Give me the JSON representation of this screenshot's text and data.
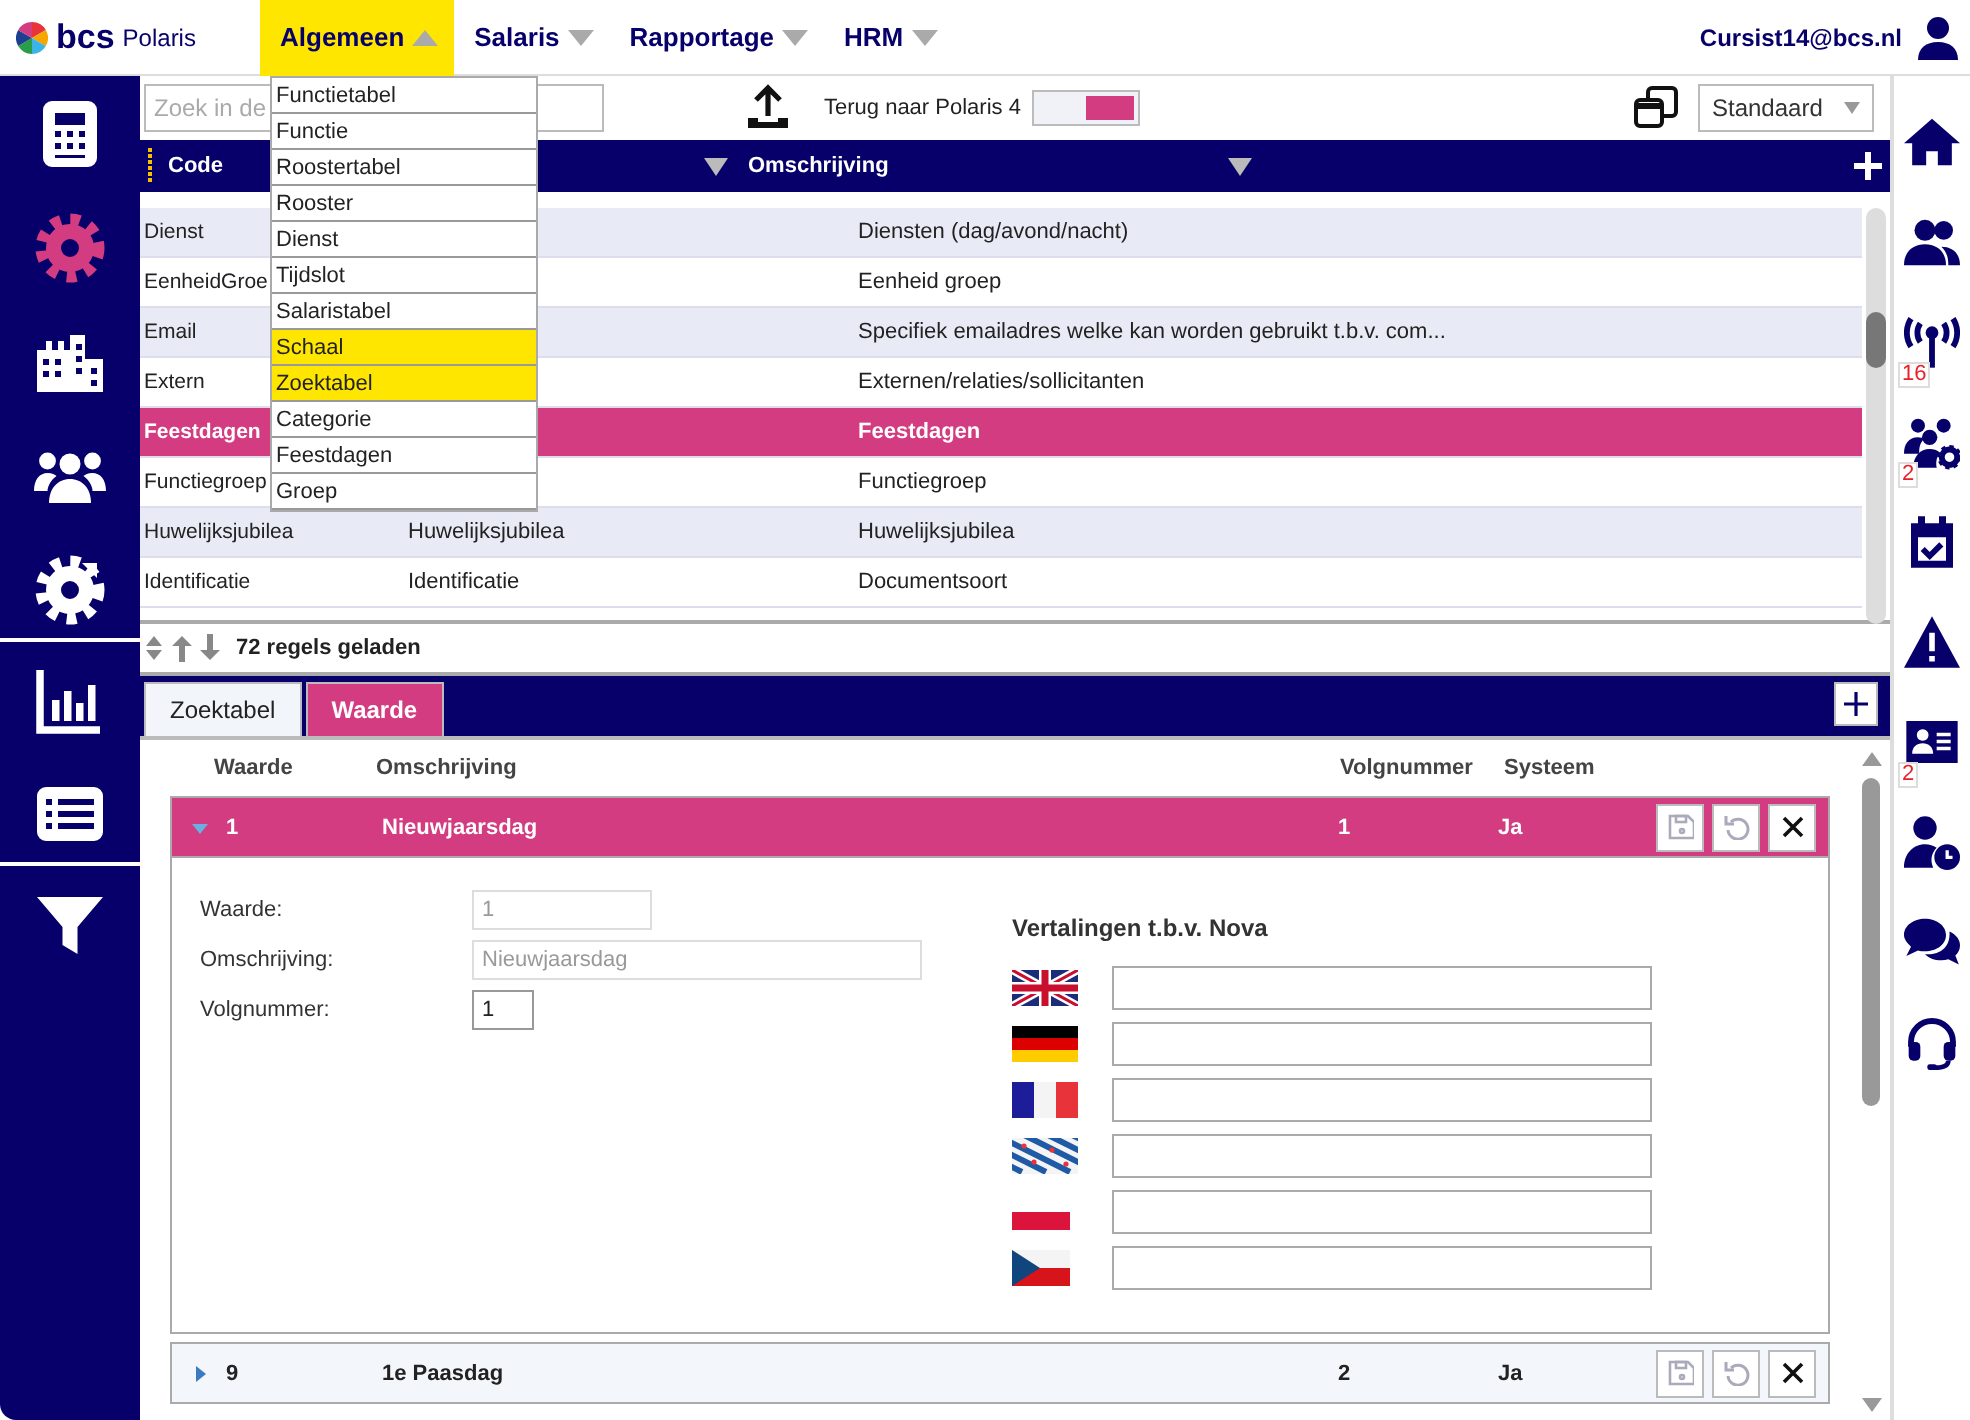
{
  "brand": {
    "name": "bcs",
    "product": "Polaris"
  },
  "menu": [
    {
      "label": "Algemeen",
      "expanded": true,
      "highlighted": true
    },
    {
      "label": "Salaris",
      "expanded": false,
      "highlighted": false
    },
    {
      "label": "Rapportage",
      "expanded": false,
      "highlighted": false
    },
    {
      "label": "HRM",
      "expanded": false,
      "highlighted": false
    }
  ],
  "user": {
    "email": "Cursist14@bcs.nl"
  },
  "dropdown": {
    "items": [
      {
        "label": "Functietabel",
        "highlighted": false
      },
      {
        "label": "Functie",
        "highlighted": false
      },
      {
        "label": "Roostertabel",
        "highlighted": false
      },
      {
        "label": "Rooster",
        "highlighted": false
      },
      {
        "label": "Dienst",
        "highlighted": false
      },
      {
        "label": "Tijdslot",
        "highlighted": false
      },
      {
        "label": "Salaristabel",
        "highlighted": false
      },
      {
        "label": "Schaal",
        "highlighted": true
      },
      {
        "label": "Zoektabel",
        "highlighted": true
      },
      {
        "label": "Categorie",
        "highlighted": false
      },
      {
        "label": "Feestdagen",
        "highlighted": false
      },
      {
        "label": "Groep",
        "highlighted": false
      }
    ]
  },
  "left_sidebar": {
    "groups": [
      [
        {
          "kind": "calculator",
          "selected": false
        },
        {
          "kind": "gear",
          "selected": true
        },
        {
          "kind": "building",
          "selected": false
        },
        {
          "kind": "people",
          "selected": false
        },
        {
          "kind": "cog",
          "selected": false
        }
      ],
      [
        {
          "kind": "chart",
          "selected": false
        },
        {
          "kind": "list",
          "selected": false
        }
      ],
      [
        {
          "kind": "filter",
          "selected": false
        }
      ]
    ]
  },
  "right_sidebar": {
    "items": [
      {
        "kind": "home"
      },
      {
        "kind": "users"
      },
      {
        "kind": "antenna",
        "badge": "16"
      },
      {
        "kind": "users-gear",
        "badge": "2"
      },
      {
        "kind": "calendar"
      },
      {
        "kind": "warning"
      },
      {
        "kind": "id-card",
        "badge": "2"
      },
      {
        "kind": "user-clock"
      },
      {
        "kind": "chat"
      },
      {
        "kind": "headset"
      }
    ]
  },
  "toolbar": {
    "search": {
      "placeholder": "Zoek in de"
    },
    "back_link": "Terug naar Polaris 4",
    "toggle": {
      "on": true
    },
    "view_select": {
      "value": "Standaard"
    }
  },
  "grid": {
    "columns": [
      "Code",
      "Omschrijving"
    ],
    "rows": [
      {
        "code": "Dienst",
        "description": "Diensten (dag/avond/nacht)",
        "selected": false
      },
      {
        "code": "EenheidGroe",
        "description": "Eenheid groep",
        "selected": false
      },
      {
        "code": "Email",
        "description": "Specifiek emailadres welke kan worden gebruikt t.b.v. com...",
        "selected": false
      },
      {
        "code": "Extern",
        "description": "Externen/relaties/sollicitanten",
        "selected": false
      },
      {
        "code": "Feestdagen",
        "description": "Feestdagen",
        "selected": true
      },
      {
        "code": "Functiegroep",
        "description": "Functiegroep",
        "selected": false
      },
      {
        "code": "Huwelijksjubilea",
        "column_2": "Huwelijksjubilea",
        "description": "Huwelijksjubilea",
        "selected": false
      },
      {
        "code": "Identificatie",
        "column_2": "Identificatie",
        "description": "Documentsoort",
        "selected": false
      }
    ],
    "status": "72 regels geladen"
  },
  "detail": {
    "tabs": [
      {
        "label": "Zoektabel",
        "selected": false
      },
      {
        "label": "Waarde",
        "selected": true
      }
    ],
    "columns": [
      "Waarde",
      "Omschrijving",
      "Volgnummer",
      "Systeem"
    ],
    "records": [
      {
        "value": "1",
        "description": "Nieuwjaarsdag",
        "sequence": "1",
        "system": "Ja",
        "expanded": true,
        "buttons": [
          {
            "kind": "save",
            "disabled": true
          },
          {
            "kind": "undo",
            "disabled": true
          },
          {
            "kind": "close",
            "disabled": false
          }
        ],
        "form": [
          {
            "label": "Waarde:",
            "value": "1",
            "disabled": true
          },
          {
            "label": "Omschrijving:",
            "value": "Nieuwjaarsdag",
            "disabled": true
          },
          {
            "label": "Volgnummer:",
            "value": "1",
            "disabled": false
          }
        ],
        "translations": {
          "title": "Vertalingen t.b.v. Nova",
          "languages": [
            {
              "kind": "uk"
            },
            {
              "kind": "de"
            },
            {
              "kind": "fr"
            },
            {
              "kind": "fy"
            },
            {
              "kind": "pl"
            },
            {
              "kind": "cz"
            }
          ]
        }
      },
      {
        "value": "9",
        "description": "1e Paasdag",
        "sequence": "2",
        "system": "Ja",
        "expanded": false,
        "buttons": [
          {
            "kind": "save",
            "disabled": true
          },
          {
            "kind": "undo",
            "disabled": true
          },
          {
            "kind": "close",
            "disabled": false
          }
        ]
      }
    ]
  }
}
